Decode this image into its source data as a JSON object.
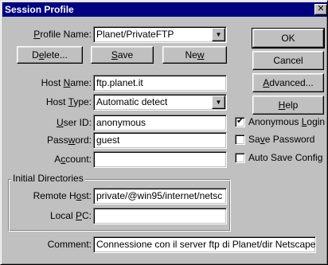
{
  "window": {
    "title": "Session Profile",
    "close_glyph": "✕"
  },
  "labels": {
    "profile_name": [
      "",
      "P",
      "rofile Name:"
    ],
    "host_name": [
      "Host ",
      "N",
      "ame:"
    ],
    "host_type": [
      "Host ",
      "T",
      "ype:"
    ],
    "user_id": [
      "",
      "U",
      "ser ID:"
    ],
    "password": [
      "Pass",
      "w",
      "ord:"
    ],
    "account": [
      "A",
      "c",
      "count:"
    ],
    "remote_host": [
      "Remote H",
      "o",
      "st:"
    ],
    "local_pc": [
      "Local ",
      "P",
      "C:"
    ],
    "comment": "Comment:"
  },
  "fields": {
    "profile_name": "Planet/PrivateFTP",
    "host_name": "ftp.planet.it",
    "host_type": "Automatic detect",
    "user_id": "anonymous",
    "password": "guest",
    "account": "",
    "remote_host": "private/@win95/internet/netsc",
    "local_pc": "",
    "comment": "Connessione con il server ftp di Planet/dir Netscape"
  },
  "buttons": {
    "delete": [
      "D",
      "e",
      "lete..."
    ],
    "save": [
      "",
      "S",
      "ave"
    ],
    "new": [
      "Ne",
      "w",
      ""
    ],
    "ok": "OK",
    "cancel": "Cancel",
    "advanced": [
      "",
      "A",
      "dvanced..."
    ],
    "help": [
      "",
      "H",
      "elp"
    ]
  },
  "checkboxes": {
    "anonymous_login": {
      "label": [
        "Anonymous ",
        "L",
        "ogin"
      ],
      "checked": true
    },
    "save_password": {
      "label": [
        "Sa",
        "v",
        "e Password"
      ],
      "checked": false
    },
    "auto_save_config": {
      "label": "Auto Save Config",
      "checked": false
    }
  },
  "group": {
    "initial_directories": "Initial Directories"
  },
  "icons": {
    "dropdown_arrow": "▼",
    "check_mark": "✔"
  },
  "colors": {
    "dialog_face": "#c0c0c0",
    "titlebar": "#000080",
    "titlebar_text": "#ffffff",
    "field_bg": "#ffffff"
  }
}
